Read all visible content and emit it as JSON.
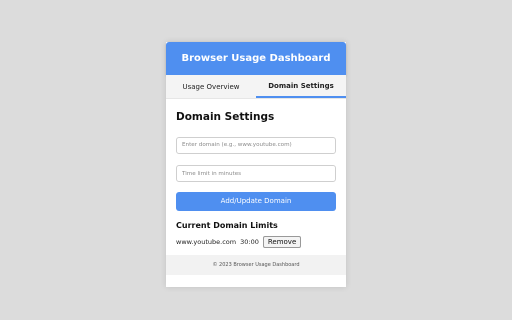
{
  "header": {
    "title": "Browser Usage Dashboard"
  },
  "tabs": [
    {
      "label": "Usage Overview",
      "active": false
    },
    {
      "label": "Domain Settings",
      "active": true
    }
  ],
  "domain_settings": {
    "title": "Domain Settings",
    "domain_input": {
      "placeholder": "Enter domain (e.g., www.youtube.com)",
      "value": ""
    },
    "limit_input": {
      "placeholder": "Time limit in minutes",
      "value": ""
    },
    "submit_label": "Add/Update Domain",
    "limits_title": "Current Domain Limits",
    "limits": [
      {
        "domain": "www.youtube.com",
        "time": "30:00",
        "remove_label": "Remove"
      }
    ]
  },
  "footer": {
    "text": "© 2023 Browser Usage Dashboard"
  },
  "colors": {
    "accent": "#4f8ff0",
    "background": "#dcdcdc"
  }
}
